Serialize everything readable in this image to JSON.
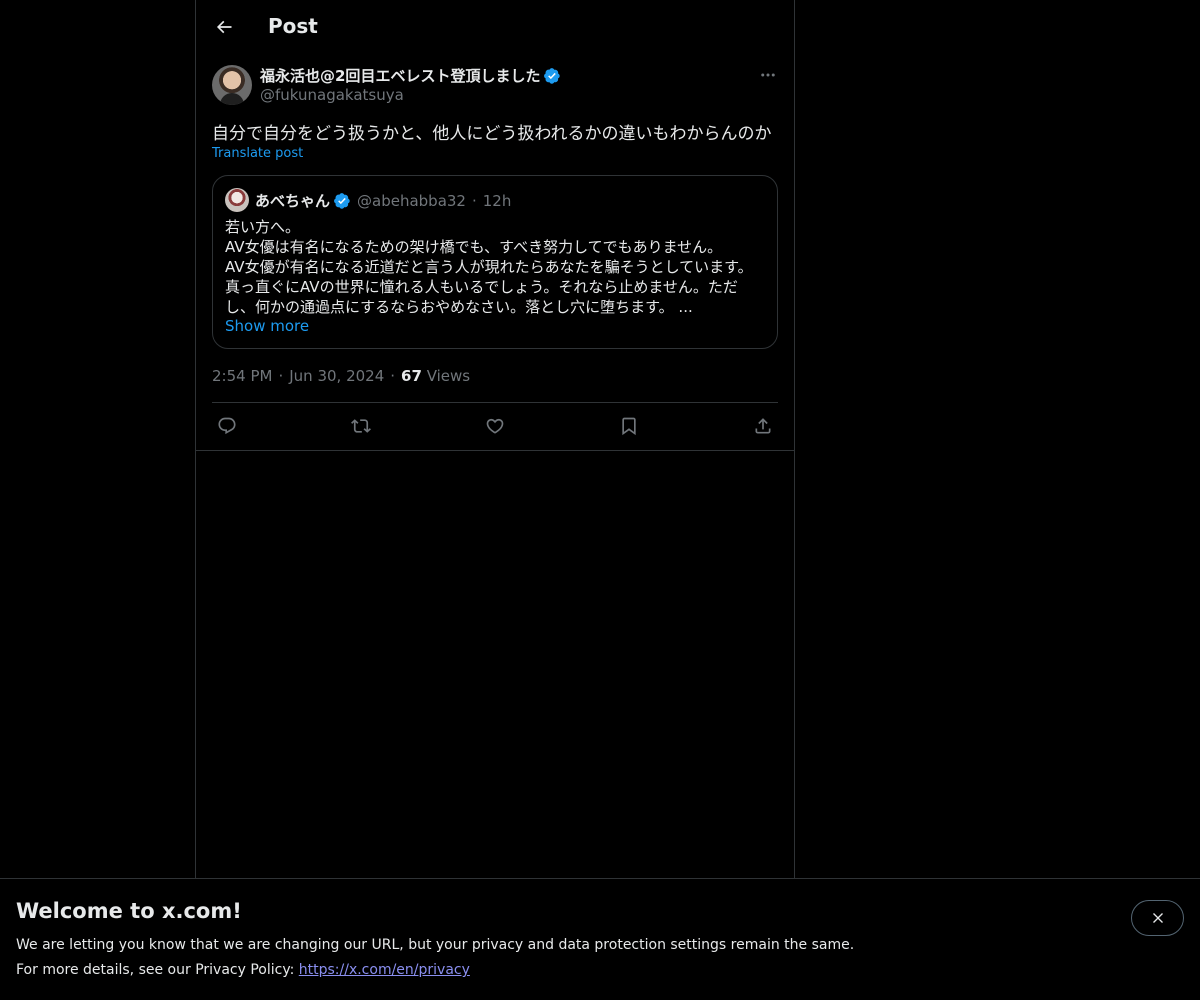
{
  "header": {
    "title": "Post",
    "back_icon": "arrow-left-icon"
  },
  "post": {
    "author_name": "福永活也@2回目エベレスト登頂しました",
    "author_handle": "@fukunagakatsuya",
    "verified": true,
    "text": "自分で自分をどう扱うかと、他人にどう扱われるかの違いもわからんのか",
    "translate_label": "Translate post",
    "time": "2:54 PM",
    "date": "Jun 30, 2024",
    "views_count": "67",
    "views_label": "Views",
    "separator": "·"
  },
  "quote": {
    "name": "あべちゃん",
    "handle": "@abehabba32",
    "separator": "·",
    "time": "12h",
    "lines": [
      "若い方へ。",
      "AV女優は有名になるための架け橋でも、すべき努力してでもありません。",
      "AV女優が有名になる近道だと言う人が現れたらあなたを騙そうとしています。",
      "真っ直ぐにAVの世界に憧れる人もいるでしょう。それなら止めません。ただ",
      "し、何かの通過点にするならおやめなさい。落とし穴に堕ちます。 ..."
    ],
    "show_more": "Show more"
  },
  "actions": [
    "reply-icon",
    "repost-icon",
    "like-icon",
    "bookmark-icon",
    "share-icon"
  ],
  "banner": {
    "title": "Welcome to x.com!",
    "line1": "We are letting you know that we are changing our URL, but your privacy and data protection settings remain the same.",
    "line2_prefix": "For more details, see our Privacy Policy: ",
    "link": "https://x.com/en/privacy",
    "close_icon": "close-icon"
  },
  "colors": {
    "background": "#000000",
    "text": "#e7e9ea",
    "muted": "#71767b",
    "accent": "#1d9bf0",
    "border": "#2f3336"
  }
}
